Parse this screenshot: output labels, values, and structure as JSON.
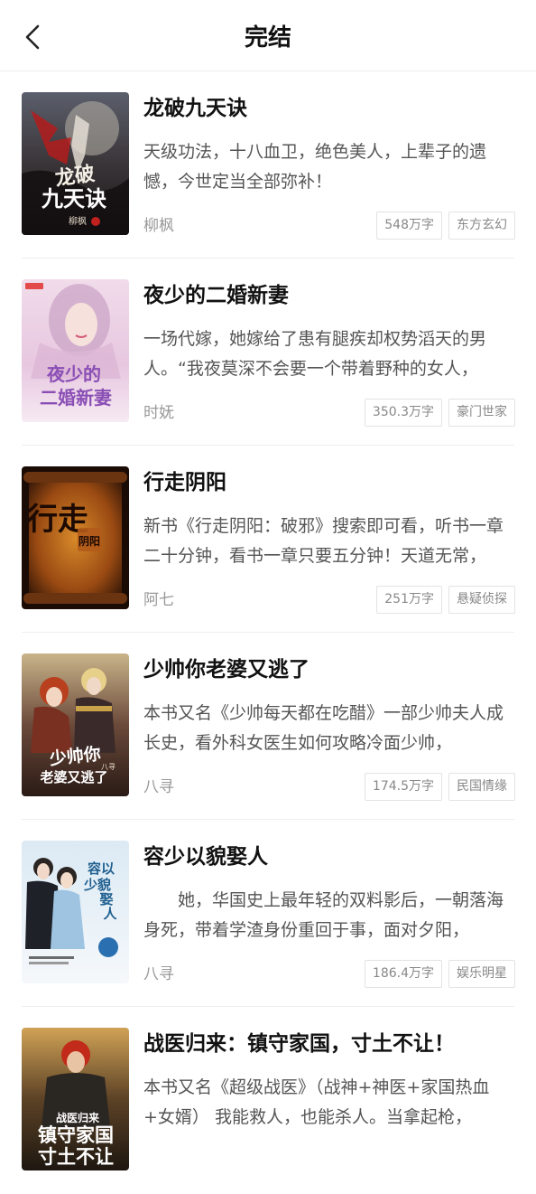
{
  "header": {
    "title": "完结",
    "back_icon": "chevron-left-icon"
  },
  "books": [
    {
      "title": "龙破九天诀",
      "desc": "天级功法，十八血卫，绝色美人，上辈子的遗憾，今世定当全部弥补！",
      "author": "柳枫",
      "words": "548万字",
      "category": "东方玄幻",
      "cover_text": [
        "龙破",
        "九天诀",
        "柳枫"
      ]
    },
    {
      "title": "夜少的二婚新妻",
      "desc": "一场代嫁，她嫁给了患有腿疾却权势滔天的男人。“我夜莫深不会要一个带着野种的女人，",
      "author": "时妩",
      "words": "350.3万字",
      "category": "豪门世家",
      "cover_text": [
        "夜少的",
        "二婚新妻"
      ]
    },
    {
      "title": "行走阴阳",
      "desc": "新书《行走阴阳：破邪》搜索即可看，听书一章二十分钟，看书一章只要五分钟！天道无常，",
      "author": "阿七",
      "words": "251万字",
      "category": "悬疑侦探",
      "cover_text": [
        "行走",
        "阴阳"
      ]
    },
    {
      "title": "少帅你老婆又逃了",
      "desc": "本书又名《少帅每天都在吃醋》一部少帅夫人成长史，看外科女医生如何攻略冷面少帅，",
      "author": "八寻",
      "words": "174.5万字",
      "category": "民国情缘",
      "cover_text": [
        "少帅你",
        "老婆又逃了",
        "八寻"
      ]
    },
    {
      "title": "容少以貌娶人",
      "desc": "　　她，华国史上最年轻的双料影后，一朝落海身死，带着学渣身份重回于事，面对夕阳，",
      "author": "八寻",
      "words": "186.4万字",
      "category": "娱乐明星",
      "cover_text": [
        "容以",
        "少貌",
        "娶",
        "人"
      ]
    },
    {
      "title": "战医归来：镇守家国，寸土不让！",
      "desc": "本书又名《超级战医》（战神+神医+家国热血+女婿） 我能救人，也能杀人。当拿起枪，",
      "author": "",
      "words": "",
      "category": "",
      "cover_text": [
        "战医归来",
        "镇守家国",
        "寸土不让"
      ]
    }
  ]
}
